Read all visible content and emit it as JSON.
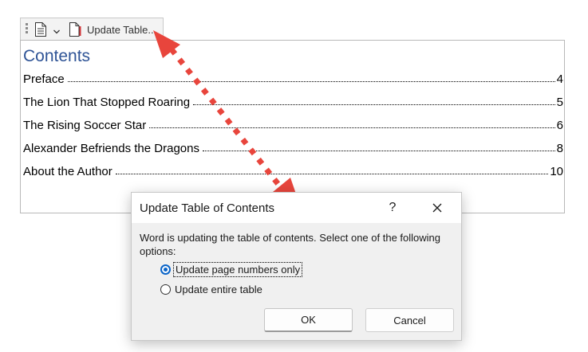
{
  "toolbar": {
    "update_table_label": "Update Table...",
    "icons": [
      "document-icon",
      "chevron-down-icon",
      "update-document-icon"
    ]
  },
  "toc": {
    "title": "Contents",
    "entries": [
      {
        "title": "Preface",
        "page": "4"
      },
      {
        "title": "The Lion That Stopped Roaring",
        "page": "5"
      },
      {
        "title": "The Rising Soccer Star",
        "page": "6"
      },
      {
        "title": "Alexander Befriends the Dragons",
        "page": "8"
      },
      {
        "title": "About the Author",
        "page": "10"
      }
    ]
  },
  "dialog": {
    "title": "Update Table of Contents",
    "help_label": "?",
    "message": "Word is updating the table of contents.  Select one of the following options:",
    "options": [
      {
        "label": "Update page numbers only",
        "selected": true
      },
      {
        "label": "Update entire table",
        "selected": false
      }
    ],
    "ok_label": "OK",
    "cancel_label": "Cancel"
  },
  "colors": {
    "title_blue": "#2f5496",
    "arrow_red": "#e8453c",
    "radio_blue": "#0a64c8"
  }
}
